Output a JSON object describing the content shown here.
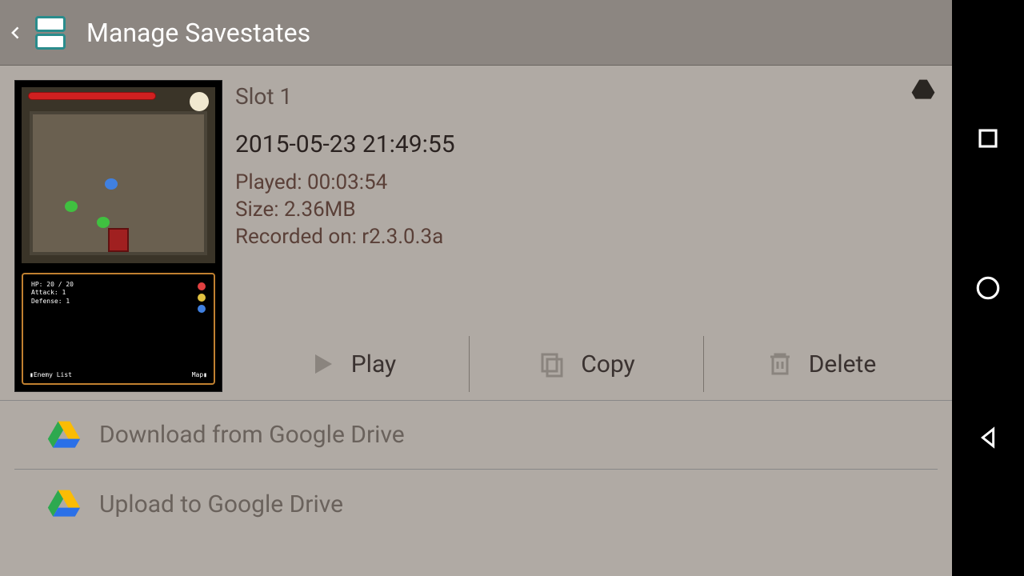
{
  "header": {
    "title": "Manage Savestates"
  },
  "savestate": {
    "slot_label": "Slot 1",
    "timestamp": "2015-05-23 21:49:55",
    "played_label": "Played: 00:03:54",
    "size_label": "Size: 2.36MB",
    "recorded_label": "Recorded on: r2.3.0.3a"
  },
  "actions": {
    "play": "Play",
    "copy": "Copy",
    "delete": "Delete"
  },
  "drive": {
    "download": "Download from Google Drive",
    "upload": "Upload to Google Drive"
  },
  "thumb": {
    "stats": "HP: 20 / 20\nAttack: 1\nDefense: 1",
    "enemy_label": "▮Enemy List",
    "map_label": "Map▮"
  }
}
